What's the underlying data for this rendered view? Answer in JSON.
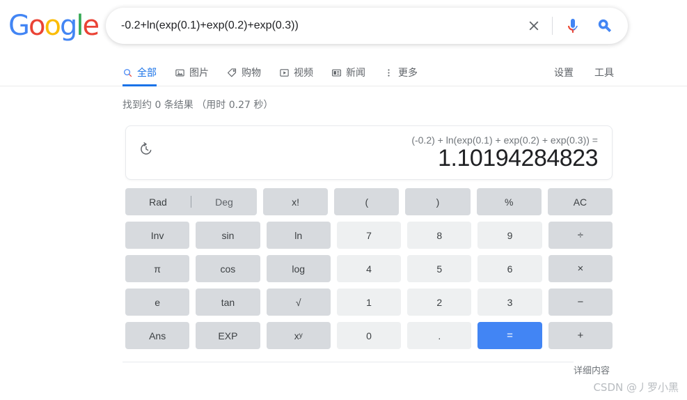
{
  "brand": {
    "name": "Google",
    "letters": [
      {
        "ch": "G",
        "color": "#4285F4"
      },
      {
        "ch": "o",
        "color": "#EA4335"
      },
      {
        "ch": "o",
        "color": "#FBBC05"
      },
      {
        "ch": "g",
        "color": "#4285F4"
      },
      {
        "ch": "l",
        "color": "#34A853"
      },
      {
        "ch": "e",
        "color": "#EA4335"
      }
    ]
  },
  "search": {
    "value": "-0.2+ln(exp(0.1)+exp(0.2)+exp(0.3))",
    "placeholder": "",
    "clear_icon": "close-icon",
    "mic_icon": "microphone-icon",
    "search_icon": "search-icon"
  },
  "nav": {
    "tabs": [
      {
        "label": "全部",
        "icon": "search-icon",
        "active": true
      },
      {
        "label": "图片",
        "icon": "image-icon",
        "active": false
      },
      {
        "label": "购物",
        "icon": "tag-icon",
        "active": false
      },
      {
        "label": "视频",
        "icon": "video-icon",
        "active": false
      },
      {
        "label": "新闻",
        "icon": "news-icon",
        "active": false
      },
      {
        "label": "更多",
        "icon": "more-vertical-icon",
        "active": false
      }
    ],
    "right": [
      {
        "label": "设置"
      },
      {
        "label": "工具"
      }
    ]
  },
  "result_stats": "找到约 0 条结果 （用时 0.27 秒）",
  "calculator": {
    "history_icon": "history-icon",
    "expression": "(-0.2) + ln(exp(0.1) + exp(0.2) + exp(0.3)) =",
    "result": "1.10194284823",
    "mode": {
      "rad": "Rad",
      "deg": "Deg",
      "selected": "Rad"
    },
    "rows": [
      [
        {
          "label": "x!",
          "type": "fn"
        },
        {
          "label": "(",
          "type": "fn"
        },
        {
          "label": ")",
          "type": "fn"
        },
        {
          "label": "%",
          "type": "fn"
        },
        {
          "label": "AC",
          "type": "fn"
        }
      ],
      [
        {
          "label": "Inv",
          "type": "fn"
        },
        {
          "label": "sin",
          "type": "fn"
        },
        {
          "label": "ln",
          "type": "fn"
        },
        {
          "label": "7",
          "type": "num"
        },
        {
          "label": "8",
          "type": "num"
        },
        {
          "label": "9",
          "type": "num"
        },
        {
          "label": "÷",
          "type": "op"
        }
      ],
      [
        {
          "label": "π",
          "type": "fn"
        },
        {
          "label": "cos",
          "type": "fn"
        },
        {
          "label": "log",
          "type": "fn"
        },
        {
          "label": "4",
          "type": "num"
        },
        {
          "label": "5",
          "type": "num"
        },
        {
          "label": "6",
          "type": "num"
        },
        {
          "label": "×",
          "type": "op"
        }
      ],
      [
        {
          "label": "e",
          "type": "fn"
        },
        {
          "label": "tan",
          "type": "fn"
        },
        {
          "label": "√",
          "type": "fn"
        },
        {
          "label": "1",
          "type": "num"
        },
        {
          "label": "2",
          "type": "num"
        },
        {
          "label": "3",
          "type": "num"
        },
        {
          "label": "−",
          "type": "op"
        }
      ],
      [
        {
          "label": "Ans",
          "type": "fn"
        },
        {
          "label": "EXP",
          "type": "fn"
        },
        {
          "label": "xy",
          "type": "fn",
          "superscript": "y",
          "base": "x"
        },
        {
          "label": "0",
          "type": "num"
        },
        {
          "label": ".",
          "type": "num"
        },
        {
          "label": "=",
          "type": "eq"
        },
        {
          "label": "+",
          "type": "op"
        }
      ]
    ]
  },
  "footer": {
    "details_label": "详细内容",
    "watermark": "CSDN @丿罗小黑"
  },
  "colors": {
    "accent_blue": "#1a73e8",
    "equals_blue": "#4285f4",
    "fn_key": "#d7dade",
    "num_key": "#eef0f1",
    "text_primary": "#202124",
    "text_secondary": "#70757a"
  }
}
